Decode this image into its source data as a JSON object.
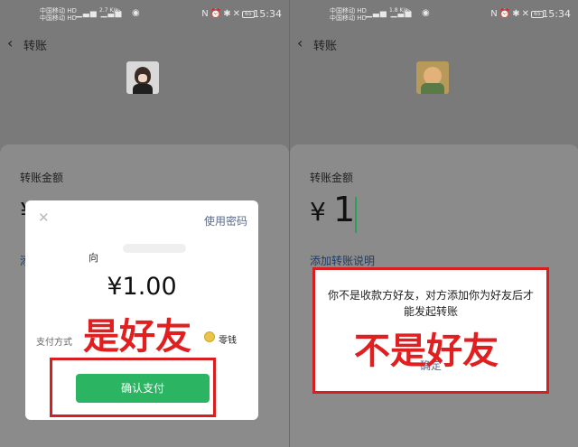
{
  "left": {
    "status": {
      "carrier1": "中国移动 HD",
      "carrier2": "中国移动 HD",
      "net_speed": "2.7 K/s",
      "battery": "65",
      "time": "15:34"
    },
    "nav": {
      "title": "转账"
    },
    "sheet": {
      "amount_label": "转账金额",
      "currency": "¥",
      "add_note": "添"
    },
    "pay_dialog": {
      "use_password": "使用密码",
      "payee_prefix": "向",
      "amount": "¥1.00",
      "method_label": "支付方式",
      "method_value": "零钱",
      "confirm": "确认支付"
    },
    "annotation": "是好友"
  },
  "right": {
    "status": {
      "carrier1": "中国移动 HD",
      "carrier2": "中国移动 HD",
      "net_speed": "1.8 K/s",
      "battery": "65",
      "time": "15:34"
    },
    "nav": {
      "title": "转账"
    },
    "sheet": {
      "amount_label": "转账金额",
      "currency": "¥",
      "amount": "1",
      "add_note": "添加转账说明"
    },
    "notice_dialog": {
      "message": "你不是收款方好友，对方添加你为好友后才能发起转账",
      "ok": "确定"
    },
    "annotation": "不是好友"
  },
  "colors": {
    "overlay": "#7a7a7a",
    "accent_green": "#2bb461",
    "annotation_red": "#e02020"
  },
  "icons": {
    "back": "chevron-left-icon",
    "close": "close-icon",
    "wallet": "coin-icon"
  }
}
